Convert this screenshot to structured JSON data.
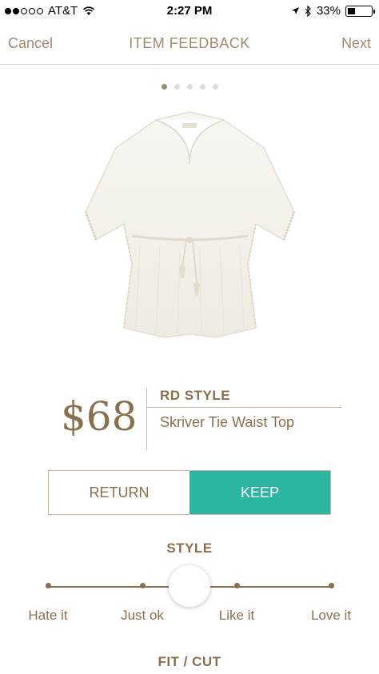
{
  "status_bar": {
    "carrier": "AT&T",
    "time": "2:27 PM",
    "battery_percent": "33%"
  },
  "nav": {
    "cancel_label": "Cancel",
    "title": "ITEM FEEDBACK",
    "next_label": "Next"
  },
  "gallery": {
    "page_count": 5,
    "active_index": 0
  },
  "item": {
    "price": "$68",
    "brand": "RD STYLE",
    "name": "Skriver Tie Waist Top"
  },
  "decision": {
    "return_label": "RETURN",
    "keep_label": "KEEP",
    "selected": "keep"
  },
  "style_rating": {
    "title": "STYLE",
    "options": [
      "Hate it",
      "Just ok",
      "Like it",
      "Love it"
    ],
    "selected_position": 0.5
  },
  "fit_section": {
    "title": "FIT / CUT"
  },
  "colors": {
    "accent": "#a08a6e",
    "text_brown": "#8a6f4e",
    "keep_teal": "#2cb5a0"
  }
}
